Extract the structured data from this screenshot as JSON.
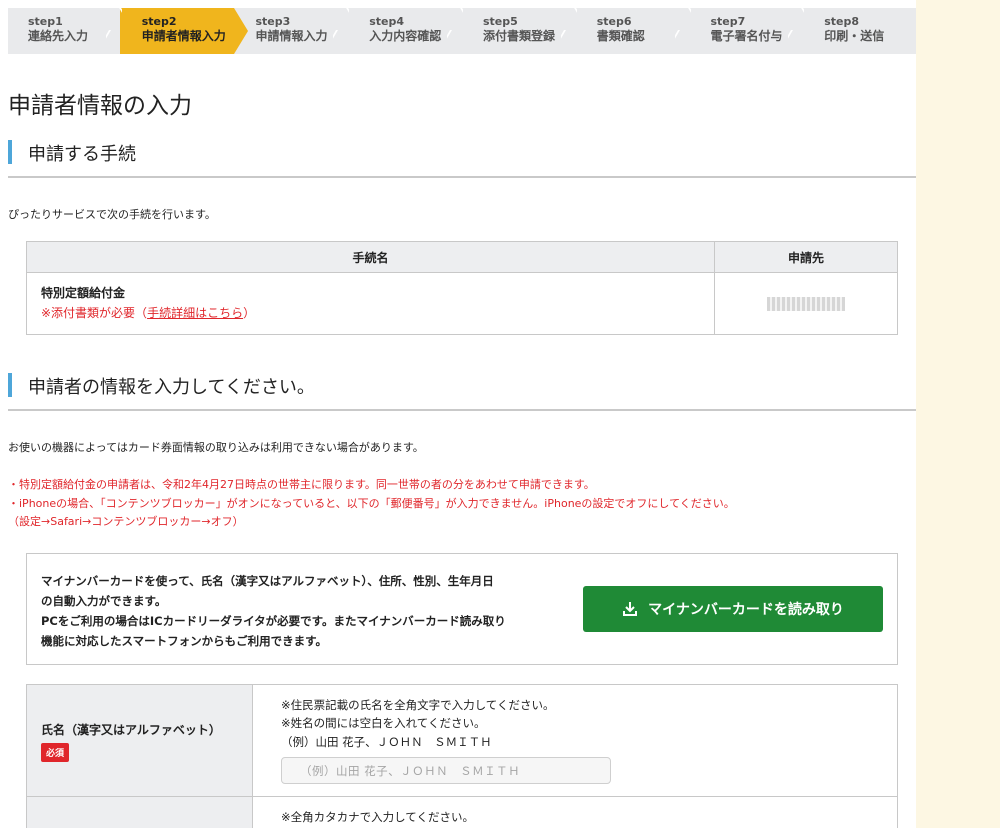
{
  "steps": [
    {
      "num": "step1",
      "label": "連絡先入力",
      "active": false
    },
    {
      "num": "step2",
      "label": "申請者情報入力",
      "active": true
    },
    {
      "num": "step3",
      "label": "申請情報入力",
      "active": false
    },
    {
      "num": "step4",
      "label": "入力内容確認",
      "active": false
    },
    {
      "num": "step5",
      "label": "添付書類登録",
      "active": false
    },
    {
      "num": "step6",
      "label": "書類確認",
      "active": false
    },
    {
      "num": "step7",
      "label": "電子署名付与",
      "active": false
    },
    {
      "num": "step8",
      "label": "印刷・送信",
      "active": false
    }
  ],
  "page_title": "申請者情報の入力",
  "section1": {
    "heading": "申請する手続",
    "intro": "ぴったりサービスで次の手続を行います。",
    "table": {
      "col_name": "手続名",
      "col_dest": "申請先",
      "procedure_name": "特別定額給付金",
      "attach_note": "※添付書類が必要（",
      "detail_link": "手続詳細はこちら",
      "attach_note_end": "）"
    }
  },
  "section2": {
    "heading": "申請者の情報を入力してください。",
    "device_note": "お使いの機器によってはカード券面情報の取り込みは利用できない場合があります。",
    "notices": [
      "・特別定額給付金の申請者は、令和2年4月27日時点の世帯主に限ります。同一世帯の者の分をあわせて申請できます。",
      "・iPhoneの場合、「コンテンツブロッカー」がオンになっていると、以下の「郵便番号」が入力できません。iPhoneの設定でオフにしてください。",
      "（設定→Safari→コンテンツブロッカー→オフ）"
    ]
  },
  "mynumber": {
    "lines": [
      "マイナンバーカードを使って、氏名（漢字又はアルファベット）、住所、性別、生年月日",
      "の自動入力ができます。",
      "PCをご利用の場合はICカードリーダライタが必要です。またマイナンバーカード読み取り",
      "機能に対応したスマートフォンからもご利用できます。"
    ],
    "button_label": "マイナンバーカードを読み取り"
  },
  "name_field": {
    "label": "氏名（漢字又はアルファベット）",
    "required": "必須",
    "hints": [
      "※住民票記載の氏名を全角文字で入力してください。",
      "※姓名の間には空白を入れてください。",
      "（例）山田 花子、ＪＯＨＮ　ＳＭＩＴＨ"
    ],
    "placeholder": "（例）山田 花子、ＪＯＨＮ　ＳＭＩＴＨ"
  },
  "kana_field": {
    "hint": "※全角カタカナで入力してください。"
  },
  "colors": {
    "active_step": "#f0b51d",
    "accent_bar": "#4ea6d9",
    "alert_red": "#e0262b",
    "button_green": "#1f8a36",
    "page_bg": "#fdf7e3"
  }
}
